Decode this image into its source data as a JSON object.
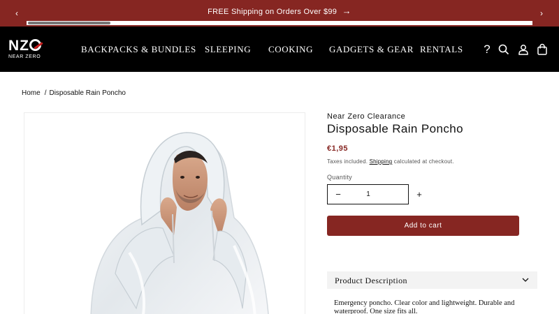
{
  "announcement": {
    "text": "FREE Shipping on Orders Over $99",
    "prev_icon": "chevron-left-icon",
    "next_icon": "chevron-right-icon",
    "link_icon": "arrow-right-icon"
  },
  "header": {
    "logo_mark": "NZ",
    "logo_text": "NEAR ZERO",
    "nav": [
      "BACKPACKS & BUNDLES",
      "SLEEPING",
      "COOKING",
      "GADGETS & GEAR",
      "RENTALS"
    ],
    "icons": [
      "help-icon",
      "search-icon",
      "account-icon",
      "cart-icon"
    ],
    "help_glyph": "?"
  },
  "breadcrumb": {
    "home": "Home",
    "separator": "/",
    "current": "Disposable Rain Poncho"
  },
  "product": {
    "vendor": "Near Zero Clearance",
    "title": "Disposable Rain Poncho",
    "price": "€1,95",
    "taxes_prefix": "Taxes included.",
    "taxes_link": "Shipping",
    "taxes_suffix": "calculated at checkout.",
    "quantity_label": "Quantity",
    "quantity_value": "1",
    "minus": "−",
    "plus": "+",
    "add_to_cart": "Add to cart",
    "description_heading": "Product Description",
    "description_text": "Emergency poncho. Clear color and lightweight. Durable and waterproof. One size fits all."
  },
  "colors": {
    "brand": "#862622",
    "header_bg": "#000000",
    "accordion_bg": "#f3f3f3"
  }
}
